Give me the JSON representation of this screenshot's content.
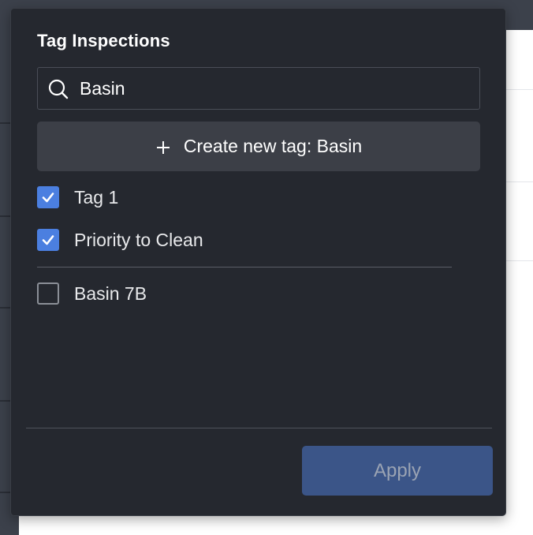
{
  "popover": {
    "title": "Tag Inspections",
    "search": {
      "value": "Basin",
      "icon": "search-icon"
    },
    "create_button_label": "Create new tag: Basin",
    "selected_tags": [
      {
        "label": "Tag 1",
        "checked": true
      },
      {
        "label": "Priority to Clean",
        "checked": true
      }
    ],
    "suggested_tags": [
      {
        "label": "Basin 7B",
        "checked": false
      }
    ],
    "apply_label": "Apply"
  },
  "colors": {
    "popover_bg": "#25282f",
    "checkbox_checked": "#4b7fe0",
    "apply_button_bg": "#3b5588",
    "create_button_bg": "#3c3f47"
  }
}
